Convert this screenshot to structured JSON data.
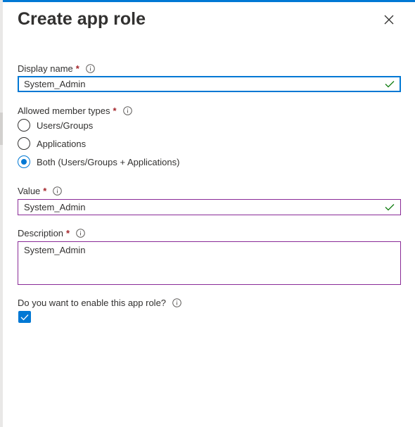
{
  "panel": {
    "title": "Create app role"
  },
  "display_name": {
    "label": "Display name",
    "required_mark": "*",
    "value": "System_Admin"
  },
  "member_types": {
    "label": "Allowed member types",
    "required_mark": "*",
    "options": [
      {
        "label": "Users/Groups",
        "checked": false
      },
      {
        "label": "Applications",
        "checked": false
      },
      {
        "label": "Both (Users/Groups + Applications)",
        "checked": true
      }
    ]
  },
  "value_field": {
    "label": "Value",
    "required_mark": "*",
    "value": "System_Admin"
  },
  "description": {
    "label": "Description",
    "required_mark": "*",
    "value": "System_Admin"
  },
  "enable": {
    "label": "Do you want to enable this app role?",
    "checked": true
  },
  "colors": {
    "accent": "#0078d4",
    "required": "#a4262c",
    "valid_check": "#107c10",
    "border": "#8a2a97"
  },
  "icons": {
    "close": "close-icon",
    "info": "info-icon",
    "valid": "checkmark-icon"
  }
}
